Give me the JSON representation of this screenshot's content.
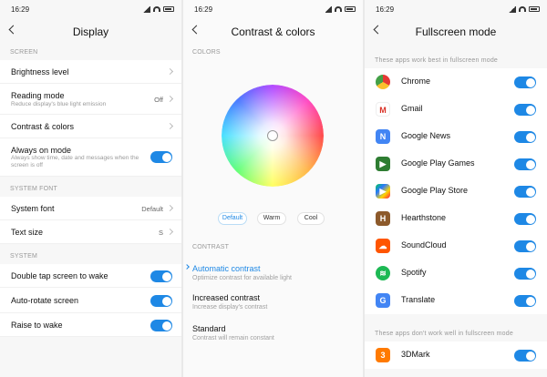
{
  "status": {
    "time": "16:29"
  },
  "display": {
    "title": "Display",
    "section_screen": "SCREEN",
    "brightness": "Brightness level",
    "reading_mode": "Reading mode",
    "reading_mode_sub": "Reduce display's blue light emission",
    "reading_mode_value": "Off",
    "contrast_colors": "Contrast & colors",
    "always_on": "Always on mode",
    "always_on_sub": "Always show time, date and messages when the screen is off",
    "section_font": "SYSTEM FONT",
    "system_font": "System font",
    "system_font_value": "Default",
    "text_size": "Text size",
    "text_size_value": "S",
    "section_system": "SYSTEM",
    "double_tap": "Double tap screen to wake",
    "auto_rotate": "Auto-rotate screen",
    "raise_wake": "Raise to wake"
  },
  "contrast": {
    "title": "Contrast & colors",
    "section_colors": "COLORS",
    "pill_default": "Default",
    "pill_warm": "Warm",
    "pill_cool": "Cool",
    "section_contrast": "CONTRAST",
    "auto": "Automatic contrast",
    "auto_sub": "Optimize contrast for available light",
    "increased": "Increased contrast",
    "increased_sub": "Increase display's contrast",
    "standard": "Standard",
    "standard_sub": "Contrast will remain constant"
  },
  "fullscreen": {
    "title": "Fullscreen mode",
    "section_best": "These apps work best in fullscreen mode",
    "apps": [
      "Chrome",
      "Gmail",
      "Google News",
      "Google Play Games",
      "Google Play Store",
      "Hearthstone",
      "SoundCloud",
      "Spotify",
      "Translate"
    ],
    "section_not": "These apps don't work well in fullscreen mode",
    "apps_not": [
      "3DMark"
    ]
  },
  "colors": {
    "accent": "#1e88e5"
  },
  "icons": [
    "back-arrow-icon",
    "chevron-right-icon",
    "chrome-icon",
    "gmail-icon",
    "google-news-icon",
    "google-play-games-icon",
    "google-play-store-icon",
    "hearthstone-icon",
    "soundcloud-icon",
    "spotify-icon",
    "translate-icon",
    "3dmark-icon"
  ]
}
